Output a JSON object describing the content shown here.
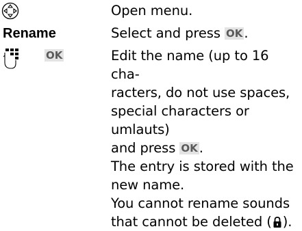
{
  "steps": [
    {
      "icon": "navigation-key-icon",
      "text": "Open menu."
    },
    {
      "term": "Rename",
      "text_before": "Select and press ",
      "key": "OK",
      "text_after": "."
    },
    {
      "icons": [
        "keypad-icon"
      ],
      "key": "OK",
      "edit_line1": "Edit the name (up to 16 cha-",
      "edit_line2": "racters, do not use spaces,",
      "edit_line3": "special characters or umlauts)",
      "edit_line4_before": "and press ",
      "edit_line4_after": ".",
      "stored_line1": "The entry is stored with the",
      "stored_line2": "new name.",
      "note_line1": "You cannot rename sounds",
      "note_line2_before": "that cannot be deleted (",
      "note_line2_after": ").",
      "note_icon": "lock-icon"
    }
  ],
  "colors": {
    "text": "#000000",
    "key_background": "#e3e3e3",
    "key_text": "#5a5a5a"
  }
}
